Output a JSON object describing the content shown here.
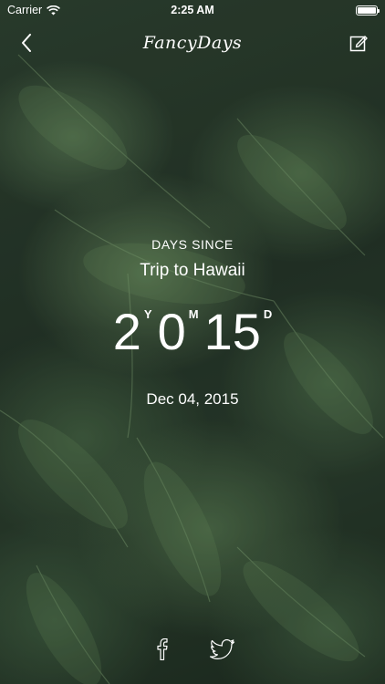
{
  "status_bar": {
    "carrier": "Carrier",
    "time": "2:25 AM",
    "wifi_icon": "wifi-icon",
    "battery_icon": "battery-icon",
    "battery_level": 1.0
  },
  "nav": {
    "title": "FancyDays",
    "back_icon": "chevron-left-icon",
    "edit_icon": "edit-icon"
  },
  "counter": {
    "heading": "DAYS SINCE",
    "event_name": "Trip to Hawaii",
    "years": "2",
    "years_unit": "Y",
    "months": "0",
    "months_unit": "M",
    "days": "15",
    "days_unit": "D",
    "date": "Dec 04, 2015"
  },
  "share": {
    "facebook_icon": "facebook-icon",
    "twitter_icon": "twitter-icon"
  },
  "colors": {
    "text": "#ffffff",
    "background": "#2b3d2e"
  }
}
